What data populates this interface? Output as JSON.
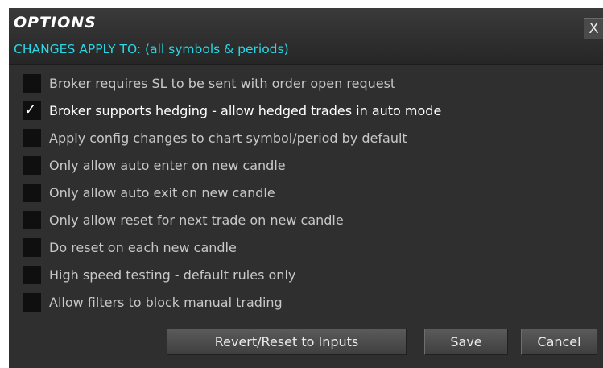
{
  "dialog": {
    "title": "OPTIONS",
    "subtitle": "CHANGES APPLY TO: (all symbols & periods)",
    "close_label": "X"
  },
  "options": [
    {
      "label": "Broker requires SL to be sent with order open request",
      "checked": false
    },
    {
      "label": "Broker supports hedging - allow hedged trades in auto mode",
      "checked": true
    },
    {
      "label": "Apply config changes to chart symbol/period by default",
      "checked": false
    },
    {
      "label": "Only allow auto enter on new candle",
      "checked": false
    },
    {
      "label": "Only allow auto exit on new candle",
      "checked": false
    },
    {
      "label": "Only allow reset for next trade on new candle",
      "checked": false
    },
    {
      "label": "Do reset on each new candle",
      "checked": false
    },
    {
      "label": "High speed testing - default rules only",
      "checked": false
    },
    {
      "label": "Allow filters to block manual trading",
      "checked": false
    }
  ],
  "check_glyph": "✓",
  "buttons": {
    "revert_label": "Revert/Reset to Inputs",
    "save_label": "Save",
    "cancel_label": "Cancel"
  },
  "colors": {
    "dialog_background": "#2f2f2f",
    "subtitle_accent": "#2ad8e6",
    "checkbox_background": "#0f0f0f"
  }
}
